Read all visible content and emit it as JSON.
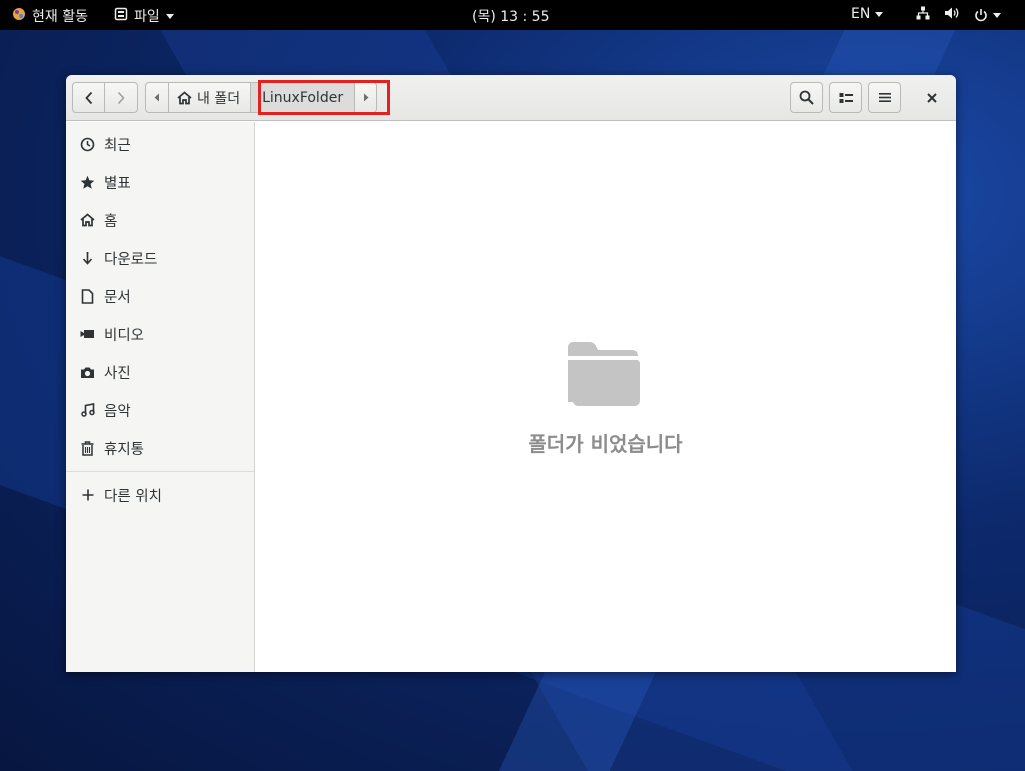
{
  "topbar": {
    "activities_label": "현재 활동",
    "app_menu_label": "파일",
    "clock": "(목) 13 : 55",
    "language": "EN"
  },
  "window": {
    "pathbar": {
      "home_label": "내 폴더",
      "current_label": "LinuxFolder"
    },
    "sidebar": {
      "items": [
        {
          "label": "최근",
          "icon": "clock-icon"
        },
        {
          "label": "별표",
          "icon": "star-icon"
        },
        {
          "label": "홈",
          "icon": "home-icon"
        },
        {
          "label": "다운로드",
          "icon": "download-icon"
        },
        {
          "label": "문서",
          "icon": "document-icon"
        },
        {
          "label": "비디오",
          "icon": "video-icon"
        },
        {
          "label": "사진",
          "icon": "camera-icon"
        },
        {
          "label": "음악",
          "icon": "music-icon"
        },
        {
          "label": "휴지통",
          "icon": "trash-icon"
        }
      ],
      "other_locations": {
        "label": "다른 위치",
        "icon": "plus-icon"
      }
    },
    "content": {
      "empty_message": "폴더가 비었습니다"
    }
  },
  "colors": {
    "highlight": "#e32121",
    "empty_text": "#8c8c8c"
  }
}
